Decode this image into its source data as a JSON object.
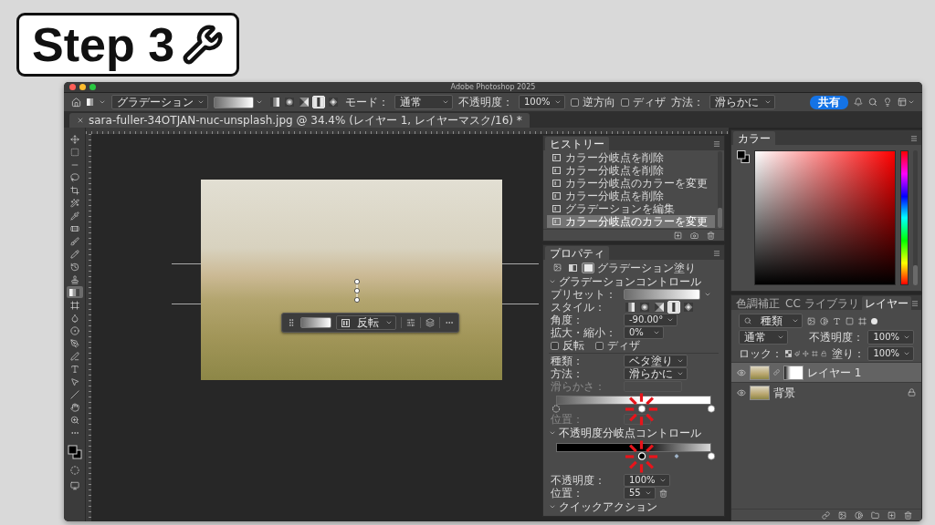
{
  "badge": {
    "text": "Step 3"
  },
  "window": {
    "title": "Adobe Photoshop 2025"
  },
  "options_bar": {
    "tool_preset": "グラデーション",
    "styles": [
      {
        "kind": "linear",
        "selected": false
      },
      {
        "kind": "radial",
        "selected": false
      },
      {
        "kind": "angle",
        "selected": false
      },
      {
        "kind": "reflected",
        "selected": true
      },
      {
        "kind": "diamond",
        "selected": false
      }
    ],
    "mode_label": "モード：",
    "mode": "通常",
    "opacity_label": "不透明度：",
    "opacity": "100%",
    "checkboxes": [
      {
        "label": "逆方向",
        "checked": false
      },
      {
        "label": "ディザ",
        "checked": false
      }
    ],
    "method_label": "方法：",
    "method": "滑らかに",
    "share_button": "共有"
  },
  "document_tab": {
    "title": "sara-fuller-34OTJAN-nuc-unsplash.jpg @ 34.4% (レイヤー 1, レイヤーマスク/16) *"
  },
  "tools": [
    {
      "kind": "move",
      "selected": false
    },
    {
      "kind": "marquee",
      "selected": false
    },
    {
      "kind": "row_marquee",
      "selected": false
    },
    {
      "kind": "lasso",
      "selected": false
    },
    {
      "kind": "crop",
      "selected": false
    },
    {
      "kind": "object_select",
      "selected": false
    },
    {
      "kind": "eyedropper",
      "selected": false
    },
    {
      "kind": "spot_heal",
      "selected": false
    },
    {
      "kind": "brush",
      "selected": false
    },
    {
      "kind": "pencil",
      "selected": false
    },
    {
      "kind": "history_brush",
      "selected": false
    },
    {
      "kind": "stamp",
      "selected": false
    },
    {
      "kind": "gradient",
      "selected": true
    },
    {
      "kind": "frame",
      "selected": false
    },
    {
      "kind": "blur",
      "selected": false
    },
    {
      "kind": "dodge",
      "selected": false
    },
    {
      "kind": "pen",
      "selected": false
    },
    {
      "kind": "curvature",
      "selected": false
    },
    {
      "kind": "type",
      "selected": false
    },
    {
      "kind": "path_select",
      "selected": false
    },
    {
      "kind": "line",
      "selected": false
    },
    {
      "kind": "hand",
      "selected": false
    },
    {
      "kind": "zoom",
      "selected": false
    },
    {
      "kind": "more",
      "selected": false
    }
  ],
  "context_bar": {
    "option": "反転"
  },
  "history": {
    "title": "ヒストリー",
    "items": [
      {
        "label": "カラー分岐点を削除",
        "selected": false
      },
      {
        "label": "カラー分岐点を削除",
        "selected": false
      },
      {
        "label": "カラー分岐点のカラーを変更",
        "selected": false
      },
      {
        "label": "カラー分岐点を削除",
        "selected": false
      },
      {
        "label": "グラデーションを編集",
        "selected": false
      },
      {
        "label": "カラー分岐点のカラーを変更",
        "selected": true
      }
    ]
  },
  "properties": {
    "title": "プロパティ",
    "view_buttons": [
      {
        "kind": "layer",
        "selected": false
      },
      {
        "kind": "mask",
        "selected": false
      },
      {
        "kind": "fill",
        "selected": true
      }
    ],
    "caption": "グラデーション塗り",
    "gradient_section": {
      "title": "グラデーションコントロール",
      "expanded": true
    },
    "preset_label": "プリセット：",
    "style_label": "スタイル：",
    "styles": [
      {
        "kind": "linear",
        "selected": false
      },
      {
        "kind": "radial",
        "selected": false
      },
      {
        "kind": "angle",
        "selected": false
      },
      {
        "kind": "reflected",
        "selected": true
      },
      {
        "kind": "diamond",
        "selected": false
      }
    ],
    "angle": {
      "label": "角度：",
      "value": "-90.00°"
    },
    "scale": {
      "label": "拡大・縮小：",
      "value": "0%"
    },
    "checkboxes": [
      {
        "label": "反転",
        "checked": false
      },
      {
        "label": "ディザ",
        "checked": false
      }
    ],
    "gradient_type": {
      "label": "種類：",
      "value": "ベタ塗り"
    },
    "method": {
      "label": "方法：",
      "value": "滑らかに"
    },
    "smoothness": {
      "label": "滑らかさ：",
      "disabled": true
    },
    "color_stops": [
      {
        "level": 0,
        "selected": true,
        "highlighted": false
      },
      {
        "level": 0.55,
        "selected": false,
        "highlighted": true
      },
      {
        "level": 1,
        "selected": false,
        "highlighted": false
      }
    ],
    "color_location": {
      "label": "位置：",
      "disabled": true
    },
    "opacity_section": {
      "title": "不透明度分岐点コントロール",
      "expanded": true
    },
    "opacity_stops": [
      {
        "level": 0.55,
        "selected": true,
        "highlighted": true
      },
      {
        "level": 1,
        "selected": false,
        "highlighted": false
      }
    ],
    "stop_opacity": {
      "label": "不透明度：",
      "value": "100%"
    },
    "location": {
      "label": "位置：",
      "value": "55"
    },
    "quick_actions": {
      "title": "クイックアクション",
      "expanded": true
    }
  },
  "color_panel": {
    "title": "カラー"
  },
  "layers_panel": {
    "tabs": [
      {
        "label": "色調補正",
        "selected": false
      },
      {
        "label": "CC ライブラリ",
        "selected": false
      },
      {
        "label": "レイヤー",
        "selected": true
      }
    ],
    "filter": "種類",
    "blend_mode": "通常",
    "opacity_label": "不透明度：",
    "opacity": "100%",
    "lock_label": "ロック：",
    "fill_label": "塗り：",
    "fill": "100%",
    "layers": [
      {
        "name": "レイヤー 1",
        "visible": true,
        "selected": true,
        "has_mask": true,
        "locked": false
      },
      {
        "name": "背景",
        "visible": true,
        "selected": false,
        "has_mask": false,
        "locked": true
      }
    ]
  }
}
